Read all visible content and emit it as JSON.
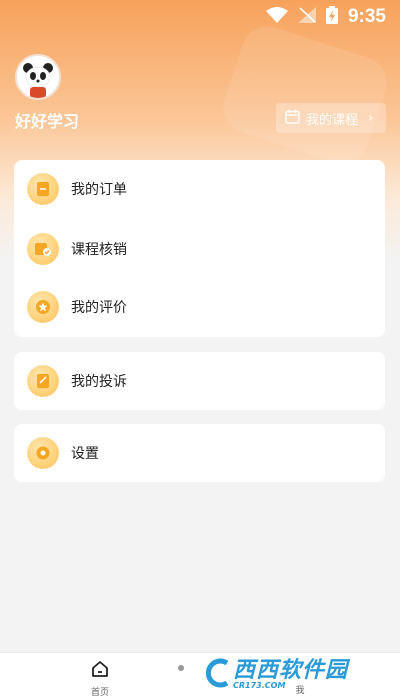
{
  "status_bar": {
    "time": "9:35"
  },
  "profile": {
    "username": "好好学习",
    "avatar_icon": "panda-avatar-icon"
  },
  "course_button": {
    "label": "我的课程",
    "icon": "calendar-icon"
  },
  "menu": {
    "group1": [
      {
        "label": "我的订单",
        "icon": "order-icon"
      },
      {
        "label": "课程核销",
        "icon": "course-verify-icon"
      },
      {
        "label": "我的评价",
        "icon": "review-icon"
      }
    ],
    "group2": [
      {
        "label": "我的投诉",
        "icon": "complaint-icon"
      }
    ],
    "group3": [
      {
        "label": "设置",
        "icon": "gear-icon"
      }
    ]
  },
  "bottom_nav": {
    "home_label": "首页",
    "me_label": "我"
  },
  "watermark": {
    "text": "西西软件园",
    "sub": "CR173.COM"
  },
  "colors": {
    "accent": "#f7a25b",
    "icon_bg": "#ffd27a",
    "icon_fg": "#f5a623"
  }
}
